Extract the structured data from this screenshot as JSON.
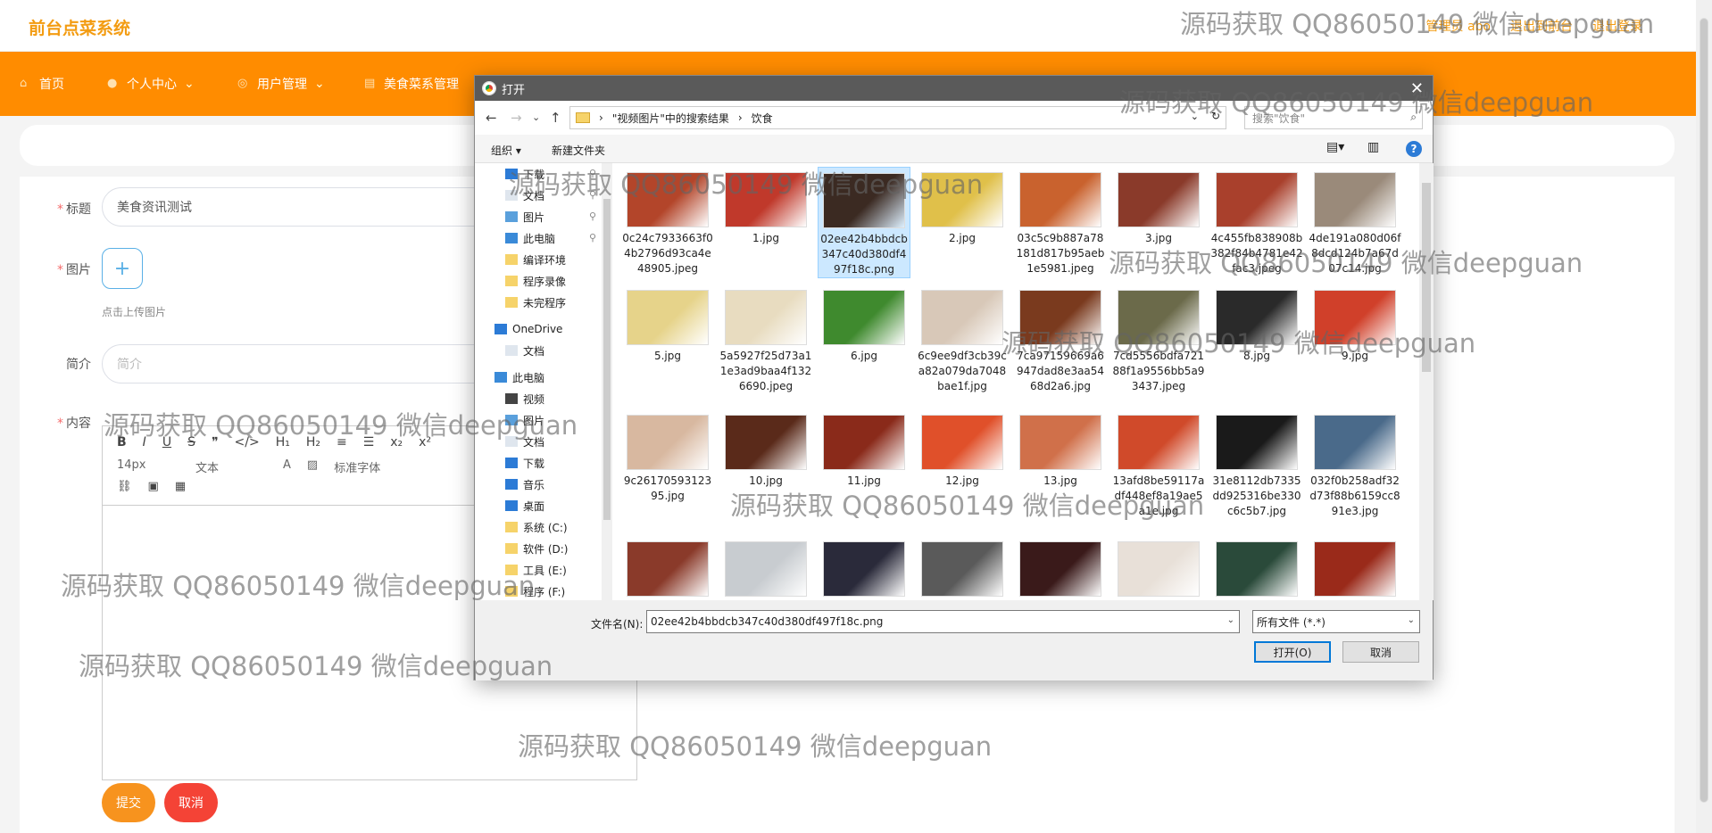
{
  "app": {
    "brand": "前台点菜系统",
    "top_links": [
      "管理员 abo",
      "退出到前台",
      "退出登录"
    ]
  },
  "nav": {
    "items": [
      {
        "label": "首页",
        "icon": "home-icon"
      },
      {
        "label": "个人中心",
        "icon": "user-icon"
      },
      {
        "label": "用户管理",
        "icon": "users-icon"
      },
      {
        "label": "美食菜系管理",
        "icon": "food-icon"
      }
    ]
  },
  "form": {
    "title_label": "标题",
    "title_value": "美食资讯测试",
    "image_label": "图片",
    "upload_hint": "点击上传图片",
    "intro_label": "简介",
    "intro_placeholder": "简介",
    "content_label": "内容",
    "toolbar_row1": [
      "B",
      "I",
      "U",
      "S",
      "❞",
      "</>",
      "H₁",
      "H₂",
      "≡",
      "☰",
      "x₂",
      "x²"
    ],
    "font_size": "14px",
    "text_style": "文本",
    "font_family": "标准字体",
    "submit_label": "提交",
    "cancel_label": "取消"
  },
  "dialog": {
    "title": "打开",
    "close": "✕",
    "path": [
      "\"视频图片\"中的搜索结果",
      "饮食"
    ],
    "search_placeholder": "搜索\"饮食\"",
    "organize": "组织 ▾",
    "new_folder": "新建文件夹",
    "tree": [
      {
        "label": "下载",
        "pinned": true
      },
      {
        "label": "文档",
        "pinned": true
      },
      {
        "label": "图片",
        "pinned": true
      },
      {
        "label": "此电脑",
        "pinned": true
      },
      {
        "label": "编译环境",
        "pinned": false
      },
      {
        "label": "程序录像",
        "pinned": false
      },
      {
        "label": "未完程序",
        "pinned": false
      },
      {
        "label": "OneDrive",
        "pinned": false
      },
      {
        "label": "文档",
        "pinned": false
      },
      {
        "label": "此电脑",
        "pinned": false
      },
      {
        "label": "视频",
        "pinned": false
      },
      {
        "label": "图片",
        "pinned": false
      },
      {
        "label": "文档",
        "pinned": false
      },
      {
        "label": "下载",
        "pinned": false
      },
      {
        "label": "音乐",
        "pinned": false
      },
      {
        "label": "桌面",
        "pinned": false
      },
      {
        "label": "系统 (C:)",
        "pinned": false
      },
      {
        "label": "软件 (D:)",
        "pinned": false
      },
      {
        "label": "工具 (E:)",
        "pinned": false
      },
      {
        "label": "程序 (F:)",
        "pinned": false
      }
    ],
    "files": [
      {
        "name": "0c24c7933663f04b2796d93ca4e48905.jpeg",
        "color": "#b3452a"
      },
      {
        "name": "1.jpg",
        "color": "#c0392b"
      },
      {
        "name": "02ee42b4bbdcb347c40d380df497f18c.png",
        "color": "#3b2a22",
        "selected": true
      },
      {
        "name": "2.jpg",
        "color": "#e0c04a"
      },
      {
        "name": "03c5c9b887a78181d817b95aeb1e5981.jpeg",
        "color": "#c9622e"
      },
      {
        "name": "3.jpg",
        "color": "#8a3a2a"
      },
      {
        "name": "4c455fb838908b382f84b4781e42fac3.jpeg",
        "color": "#a9402c"
      },
      {
        "name": "4de191a080d06f8dcd124b7a67d07c14.jpg",
        "color": "#9a8a7a"
      },
      {
        "name": "5.jpg",
        "color": "#e6d38a"
      },
      {
        "name": "5a5927f25d73a11e3ad9baa4f1326690.jpeg",
        "color": "#e8dcc0"
      },
      {
        "name": "6.jpg",
        "color": "#3f8a2e"
      },
      {
        "name": "6c9ee9df3cb39ca82a079da7048bae1f.jpg",
        "color": "#d8c8b8"
      },
      {
        "name": "7ca97159669a6947dad8e3aa5468d2a6.jpg",
        "color": "#7a3a1e"
      },
      {
        "name": "7cd5556bdfa72188f1a9556bb5a93437.jpeg",
        "color": "#6b6a4a"
      },
      {
        "name": "8.jpg",
        "color": "#2a2a2a"
      },
      {
        "name": "9.jpg",
        "color": "#d0402a"
      },
      {
        "name": "9c2617059312395.jpg",
        "color": "#d8b8a0"
      },
      {
        "name": "10.jpg",
        "color": "#5a2a1a"
      },
      {
        "name": "11.jpg",
        "color": "#8a2a1a"
      },
      {
        "name": "12.jpg",
        "color": "#e0502a"
      },
      {
        "name": "13.jpg",
        "color": "#d0704a"
      },
      {
        "name": "13afd8be59117adf448ef8a19ae5a1e.jpg",
        "color": "#d04a2a"
      },
      {
        "name": "31e8112db7335dd925316be330c6c5b7.jpg",
        "color": "#1a1a1a"
      },
      {
        "name": "032f0b258adf32d73f88b6159cc891e3.jpg",
        "color": "#4a6a8a"
      },
      {
        "name": "",
        "color": "#8a3a2a"
      },
      {
        "name": "",
        "color": "#c8ccd0"
      },
      {
        "name": "",
        "color": "#2a2a3a"
      },
      {
        "name": "",
        "color": "#5a5a5a"
      },
      {
        "name": "",
        "color": "#3a1a1a"
      },
      {
        "name": "",
        "color": "#e8e0d8"
      },
      {
        "name": "",
        "color": "#2a4a3a"
      },
      {
        "name": "",
        "color": "#9a2a1a"
      }
    ],
    "filename_label": "文件名(N):",
    "filename_value": "02ee42b4bbdcb347c40d380df497f18c.png",
    "filetype": "所有文件 (*.*)",
    "open_label": "打开(O)",
    "cancel_label": "取消"
  },
  "watermark": "源码获取 QQ86050149 微信deepguan",
  "colors": {
    "accent": "#ff8c00",
    "brand": "#f39c12",
    "submit": "#f7931e",
    "cancel": "#f44336"
  }
}
